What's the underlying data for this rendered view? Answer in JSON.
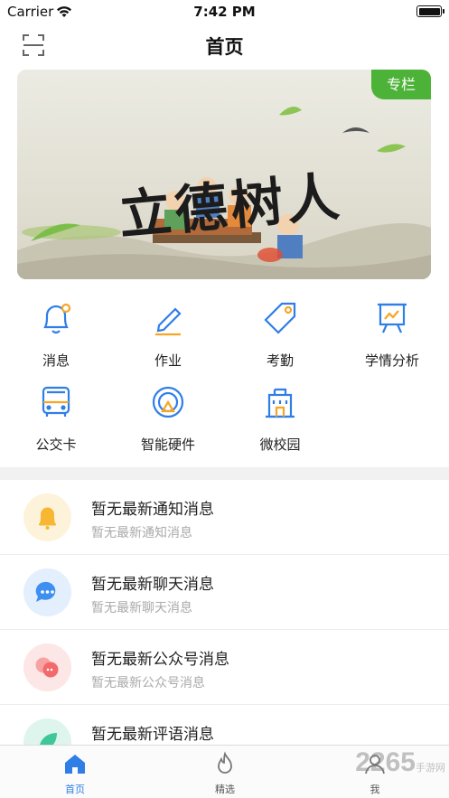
{
  "status_bar": {
    "carrier": "Carrier",
    "time": "7:42 PM"
  },
  "nav": {
    "title": "首页",
    "scan_icon": "scan-icon"
  },
  "banner": {
    "tag": "专栏",
    "calligraphy": "立德树人"
  },
  "grid": [
    {
      "label": "消息",
      "icon": "bell-icon"
    },
    {
      "label": "作业",
      "icon": "pencil-icon"
    },
    {
      "label": "考勤",
      "icon": "tag-icon"
    },
    {
      "label": "学情分析",
      "icon": "chart-board-icon"
    },
    {
      "label": "公交卡",
      "icon": "bus-icon"
    },
    {
      "label": "智能硬件",
      "icon": "smart-device-icon"
    },
    {
      "label": "微校园",
      "icon": "campus-building-icon"
    }
  ],
  "messages": [
    {
      "title": "暂无最新通知消息",
      "subtitle": "暂无最新通知消息",
      "icon": "bell-icon",
      "color": "#f7b733"
    },
    {
      "title": "暂无最新聊天消息",
      "subtitle": "暂无最新聊天消息",
      "icon": "chat-icon",
      "color": "#3d8ff0"
    },
    {
      "title": "暂无最新公众号消息",
      "subtitle": "暂无最新公众号消息",
      "icon": "official-account-icon",
      "color": "#f26a6a"
    },
    {
      "title": "暂无最新评语消息",
      "subtitle": "",
      "icon": "leaf-icon",
      "color": "#3fc79a"
    }
  ],
  "tabs": [
    {
      "label": "首页",
      "icon": "home-icon",
      "active": true
    },
    {
      "label": "精选",
      "icon": "flame-icon",
      "active": false
    },
    {
      "label": "我",
      "icon": "person-icon",
      "active": false
    }
  ],
  "watermark": {
    "main": "2265",
    "sub": "手游网"
  },
  "colors": {
    "accent": "#2f7ee8",
    "tag_green": "#4cb338",
    "text_secondary": "#aaaaaa"
  }
}
